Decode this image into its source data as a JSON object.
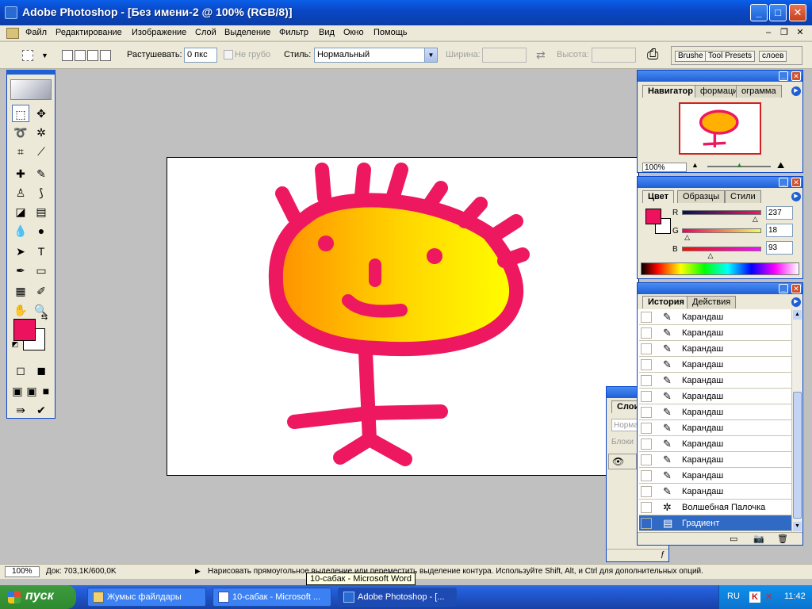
{
  "window": {
    "title": "Adobe Photoshop - [Без имени-2 @ 100% (RGB/8)]"
  },
  "menu": {
    "items": [
      "Файл",
      "Редактирование",
      "Изображение",
      "Слой",
      "Выделение",
      "Фильтр",
      "Вид",
      "Окно",
      "Помощь"
    ]
  },
  "options": {
    "feather_label": "Растушевать:",
    "feather_value": "0 пкс",
    "antialias_label": "Не грубо",
    "style_label": "Стиль:",
    "style_value": "Нормальный",
    "width_label": "Ширина:",
    "height_label": "Высота:",
    "well_tabs": [
      "Brushe",
      "Tool Presets",
      "слоев"
    ]
  },
  "colors": {
    "foreground": "#ed125d",
    "background": "#ffffff",
    "accent": "#1f5fd6",
    "drawing_pink": "#ed185f"
  },
  "navigator": {
    "tabs": [
      "Навигатор",
      "формация",
      "ограмма"
    ],
    "zoom": "100%"
  },
  "color_panel": {
    "tabs": [
      "Цвет",
      "Образцы",
      "Стили"
    ],
    "channels": [
      {
        "label": "R",
        "value": "237",
        "fraction": 0.929
      },
      {
        "label": "G",
        "value": "18",
        "fraction": 0.071
      },
      {
        "label": "B",
        "value": "93",
        "fraction": 0.365
      }
    ]
  },
  "history": {
    "tabs": [
      "История",
      "Действия"
    ],
    "items": [
      "Карандаш",
      "Карандаш",
      "Карандаш",
      "Карандаш",
      "Карандаш",
      "Карандаш",
      "Карандаш",
      "Карандаш",
      "Карандаш",
      "Карандаш",
      "Карандаш",
      "Карандаш",
      "Волшебная Палочка",
      "Градиент"
    ],
    "icons": [
      "pencil-icon",
      "pencil-icon",
      "pencil-icon",
      "pencil-icon",
      "pencil-icon",
      "pencil-icon",
      "pencil-icon",
      "pencil-icon",
      "pencil-icon",
      "pencil-icon",
      "pencil-icon",
      "pencil-icon",
      "magic-wand-icon",
      "gradient-icon"
    ]
  },
  "layers": {
    "tab": "Слои",
    "mode": "Норма",
    "lock": "Блоки"
  },
  "status": {
    "zoom": "100%",
    "doc": "Док: 703,1K/600,0K",
    "hint": "Нарисовать прямоугольное выделение или переместить выделение контура.  Используйте Shift, Alt, и Ctrl для дополнительных опций."
  },
  "tooltip": "10-сабак - Microsoft Word",
  "taskbar": {
    "start": "пуск",
    "tasks": [
      "Жумыс файлдары",
      "10-сабак - Microsoft ...",
      "Adobe Photoshop - [..."
    ],
    "lang": "RU",
    "clock": "11:42"
  }
}
